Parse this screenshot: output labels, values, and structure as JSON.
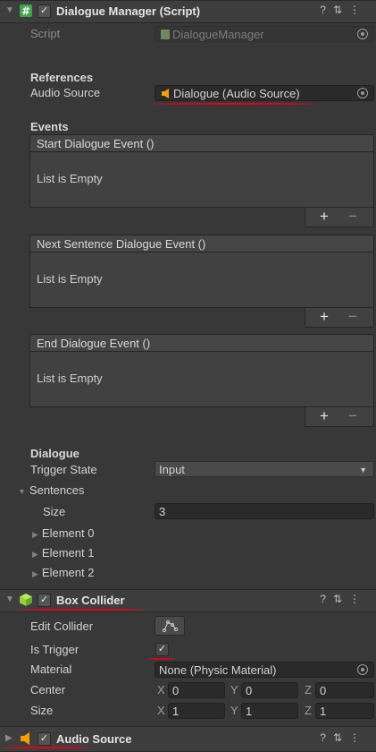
{
  "dialogue_manager": {
    "title": "Dialogue Manager (Script)",
    "script_label": "Script",
    "script_value": "DialogueManager",
    "references_heading": "References",
    "audio_source_label": "Audio Source",
    "audio_source_value": "Dialogue (Audio Source)",
    "events_heading": "Events",
    "events": [
      {
        "name": "Start Dialogue Event ()",
        "empty": "List is Empty"
      },
      {
        "name": "Next Sentence Dialogue Event ()",
        "empty": "List is Empty"
      },
      {
        "name": "End Dialogue Event ()",
        "empty": "List is Empty"
      }
    ],
    "plus": "+",
    "minus": "−",
    "dialogue_heading": "Dialogue",
    "trigger_state_label": "Trigger State",
    "trigger_state_value": "Input",
    "sentences_label": "Sentences",
    "size_label": "Size",
    "size_value": "3",
    "elements": [
      "Element 0",
      "Element 1",
      "Element 2"
    ]
  },
  "box_collider": {
    "title": "Box Collider",
    "edit_collider_label": "Edit Collider",
    "is_trigger_label": "Is Trigger",
    "is_trigger_checked": true,
    "material_label": "Material",
    "material_value": "None (Physic Material)",
    "center_label": "Center",
    "center": {
      "x": "0",
      "y": "0",
      "z": "0"
    },
    "size_label": "Size",
    "size": {
      "x": "1",
      "y": "1",
      "z": "1"
    },
    "axis": {
      "x": "X",
      "y": "Y",
      "z": "Z"
    }
  },
  "audio_source": {
    "title": "Audio Source"
  },
  "header_icons": {
    "help": "?",
    "settings": "⇅",
    "menu": "⋮"
  },
  "colors": {
    "accent_red": "#e3001b",
    "script_icon_green": "#3fa34d",
    "collider_icon_green": "#8ed13a",
    "speaker_orange": "#f0a000"
  }
}
